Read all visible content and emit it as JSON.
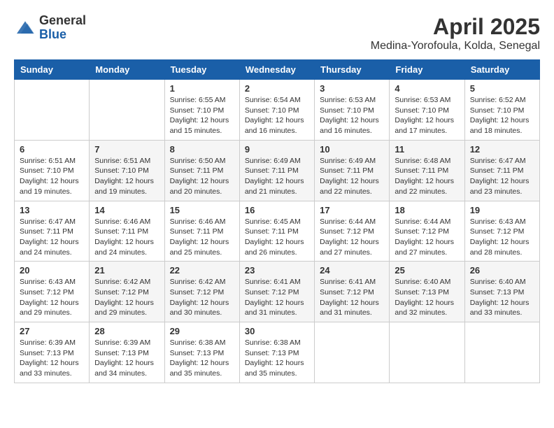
{
  "header": {
    "logo_general": "General",
    "logo_blue": "Blue",
    "month_title": "April 2025",
    "location": "Medina-Yorofoula, Kolda, Senegal"
  },
  "weekdays": [
    "Sunday",
    "Monday",
    "Tuesday",
    "Wednesday",
    "Thursday",
    "Friday",
    "Saturday"
  ],
  "weeks": [
    [
      {
        "day": null,
        "info": null
      },
      {
        "day": null,
        "info": null
      },
      {
        "day": "1",
        "info": "Sunrise: 6:55 AM\nSunset: 7:10 PM\nDaylight: 12 hours and 15 minutes."
      },
      {
        "day": "2",
        "info": "Sunrise: 6:54 AM\nSunset: 7:10 PM\nDaylight: 12 hours and 16 minutes."
      },
      {
        "day": "3",
        "info": "Sunrise: 6:53 AM\nSunset: 7:10 PM\nDaylight: 12 hours and 16 minutes."
      },
      {
        "day": "4",
        "info": "Sunrise: 6:53 AM\nSunset: 7:10 PM\nDaylight: 12 hours and 17 minutes."
      },
      {
        "day": "5",
        "info": "Sunrise: 6:52 AM\nSunset: 7:10 PM\nDaylight: 12 hours and 18 minutes."
      }
    ],
    [
      {
        "day": "6",
        "info": "Sunrise: 6:51 AM\nSunset: 7:10 PM\nDaylight: 12 hours and 19 minutes."
      },
      {
        "day": "7",
        "info": "Sunrise: 6:51 AM\nSunset: 7:10 PM\nDaylight: 12 hours and 19 minutes."
      },
      {
        "day": "8",
        "info": "Sunrise: 6:50 AM\nSunset: 7:11 PM\nDaylight: 12 hours and 20 minutes."
      },
      {
        "day": "9",
        "info": "Sunrise: 6:49 AM\nSunset: 7:11 PM\nDaylight: 12 hours and 21 minutes."
      },
      {
        "day": "10",
        "info": "Sunrise: 6:49 AM\nSunset: 7:11 PM\nDaylight: 12 hours and 22 minutes."
      },
      {
        "day": "11",
        "info": "Sunrise: 6:48 AM\nSunset: 7:11 PM\nDaylight: 12 hours and 22 minutes."
      },
      {
        "day": "12",
        "info": "Sunrise: 6:47 AM\nSunset: 7:11 PM\nDaylight: 12 hours and 23 minutes."
      }
    ],
    [
      {
        "day": "13",
        "info": "Sunrise: 6:47 AM\nSunset: 7:11 PM\nDaylight: 12 hours and 24 minutes."
      },
      {
        "day": "14",
        "info": "Sunrise: 6:46 AM\nSunset: 7:11 PM\nDaylight: 12 hours and 24 minutes."
      },
      {
        "day": "15",
        "info": "Sunrise: 6:46 AM\nSunset: 7:11 PM\nDaylight: 12 hours and 25 minutes."
      },
      {
        "day": "16",
        "info": "Sunrise: 6:45 AM\nSunset: 7:11 PM\nDaylight: 12 hours and 26 minutes."
      },
      {
        "day": "17",
        "info": "Sunrise: 6:44 AM\nSunset: 7:12 PM\nDaylight: 12 hours and 27 minutes."
      },
      {
        "day": "18",
        "info": "Sunrise: 6:44 AM\nSunset: 7:12 PM\nDaylight: 12 hours and 27 minutes."
      },
      {
        "day": "19",
        "info": "Sunrise: 6:43 AM\nSunset: 7:12 PM\nDaylight: 12 hours and 28 minutes."
      }
    ],
    [
      {
        "day": "20",
        "info": "Sunrise: 6:43 AM\nSunset: 7:12 PM\nDaylight: 12 hours and 29 minutes."
      },
      {
        "day": "21",
        "info": "Sunrise: 6:42 AM\nSunset: 7:12 PM\nDaylight: 12 hours and 29 minutes."
      },
      {
        "day": "22",
        "info": "Sunrise: 6:42 AM\nSunset: 7:12 PM\nDaylight: 12 hours and 30 minutes."
      },
      {
        "day": "23",
        "info": "Sunrise: 6:41 AM\nSunset: 7:12 PM\nDaylight: 12 hours and 31 minutes."
      },
      {
        "day": "24",
        "info": "Sunrise: 6:41 AM\nSunset: 7:12 PM\nDaylight: 12 hours and 31 minutes."
      },
      {
        "day": "25",
        "info": "Sunrise: 6:40 AM\nSunset: 7:13 PM\nDaylight: 12 hours and 32 minutes."
      },
      {
        "day": "26",
        "info": "Sunrise: 6:40 AM\nSunset: 7:13 PM\nDaylight: 12 hours and 33 minutes."
      }
    ],
    [
      {
        "day": "27",
        "info": "Sunrise: 6:39 AM\nSunset: 7:13 PM\nDaylight: 12 hours and 33 minutes."
      },
      {
        "day": "28",
        "info": "Sunrise: 6:39 AM\nSunset: 7:13 PM\nDaylight: 12 hours and 34 minutes."
      },
      {
        "day": "29",
        "info": "Sunrise: 6:38 AM\nSunset: 7:13 PM\nDaylight: 12 hours and 35 minutes."
      },
      {
        "day": "30",
        "info": "Sunrise: 6:38 AM\nSunset: 7:13 PM\nDaylight: 12 hours and 35 minutes."
      },
      {
        "day": null,
        "info": null
      },
      {
        "day": null,
        "info": null
      },
      {
        "day": null,
        "info": null
      }
    ]
  ]
}
